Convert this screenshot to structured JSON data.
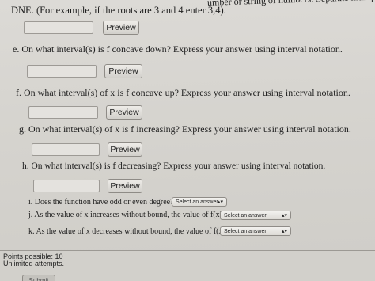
{
  "top_text": {
    "tail": "umber or string of numbers. Separate multiple answers w",
    "line": "DNE. (For example, if the roots are 3 and 4 enter 3,4)."
  },
  "preview_label": "Preview",
  "questions": {
    "e": "e. On what interval(s) is f concave down? Express your answer using interval notation.",
    "f": "f. On what interval(s) of x is f concave up? Express your answer using interval notation.",
    "g": "g. On what interval(s) of x is f increasing? Express your answer using interval notation.",
    "h": "h. On what interval(s) is f decreasing? Express your answer using interval notation.",
    "i": "i. Does the function have odd or even degree?",
    "j": "j. As the value of x increases without bound, the value of f(x)",
    "k": "k. As the value of x decreases without bound, the value of f(x)"
  },
  "selects": {
    "i": "Select an answer",
    "j": "Select an answer",
    "k": "Select an answer"
  },
  "footer": {
    "points": "Points possible: 10",
    "attempts": "Unlimited attempts.",
    "submit": "Submit"
  }
}
